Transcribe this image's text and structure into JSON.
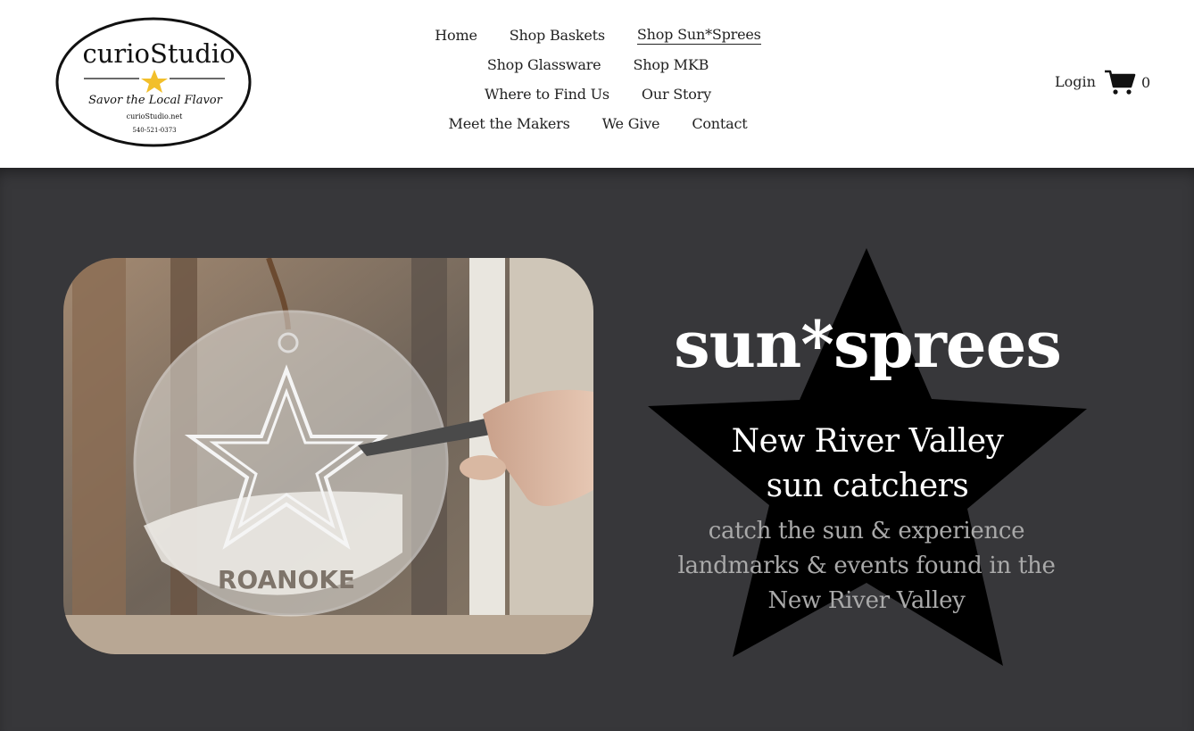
{
  "logo": {
    "brand": "curioStudio",
    "tagline": "Savor the Local Flavor",
    "website": "curioStudio.net",
    "phone": "540-521-0373"
  },
  "nav": {
    "items": [
      {
        "label": "Home"
      },
      {
        "label": "Shop Baskets"
      },
      {
        "label": "Shop Sun*Sprees"
      },
      {
        "label": "Shop Glassware"
      },
      {
        "label": "Shop MKB"
      },
      {
        "label": "Where to Find Us"
      },
      {
        "label": "Our Story"
      },
      {
        "label": "Meet the Makers"
      },
      {
        "label": "We Give"
      },
      {
        "label": "Contact"
      }
    ],
    "active": "Shop Sun*Sprees"
  },
  "header": {
    "login_label": "Login",
    "cart_count": "0",
    "cart_icon": "shopping-cart-icon"
  },
  "hero": {
    "title": "sun*sprees",
    "subtitle_line1": "New River Valley",
    "subtitle_line2": "sun catchers",
    "desc_line1": "catch the sun & experience",
    "desc_line2": "landmarks & events found in the",
    "desc_line3": "New River Valley",
    "photo_text": "ROANOKE",
    "colors": {
      "background": "#37373a",
      "star": "#000000",
      "title": "#ffffff",
      "desc": "#a9a9a9"
    }
  }
}
